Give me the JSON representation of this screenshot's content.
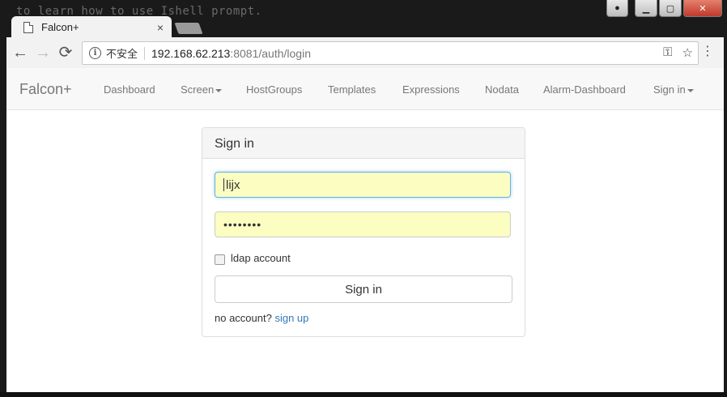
{
  "background": {
    "terminal_text": "to learn how to use Ishell prompt."
  },
  "window": {
    "controls": [
      "user",
      "minimize",
      "maximize",
      "close"
    ]
  },
  "tab": {
    "title": "Falcon+",
    "close_glyph": "×"
  },
  "toolbar": {
    "back_glyph": "←",
    "forward_glyph": "→",
    "reload_glyph": "⟳",
    "security_label": "不安全",
    "url_host": "192.168.62.213",
    "url_path": ":8081/auth/login",
    "key_glyph": "⚿",
    "star_glyph": "☆",
    "menu_glyph": "⋮"
  },
  "navbar": {
    "brand": "Falcon+",
    "items": [
      {
        "label": "Dashboard"
      },
      {
        "label": "Screen"
      },
      {
        "label": "HostGroups"
      },
      {
        "label": "Templates"
      },
      {
        "label": "Expressions"
      },
      {
        "label": "Nodata"
      },
      {
        "label": "Alarm-Dashboard"
      },
      {
        "label": "Sign in"
      }
    ]
  },
  "form": {
    "title": "Sign in",
    "username_value": "lijx",
    "password_value": "••••••••",
    "ldap_label": "ldap account",
    "ldap_checked": false,
    "submit_label": "Sign in",
    "no_account_text": "no account?",
    "signup_link": "sign up"
  },
  "colors": {
    "autofill_bg": "#fbfdc1",
    "link": "#337ab7",
    "focus_border": "#66afe9",
    "navbar_bg": "#f8f8f8"
  }
}
